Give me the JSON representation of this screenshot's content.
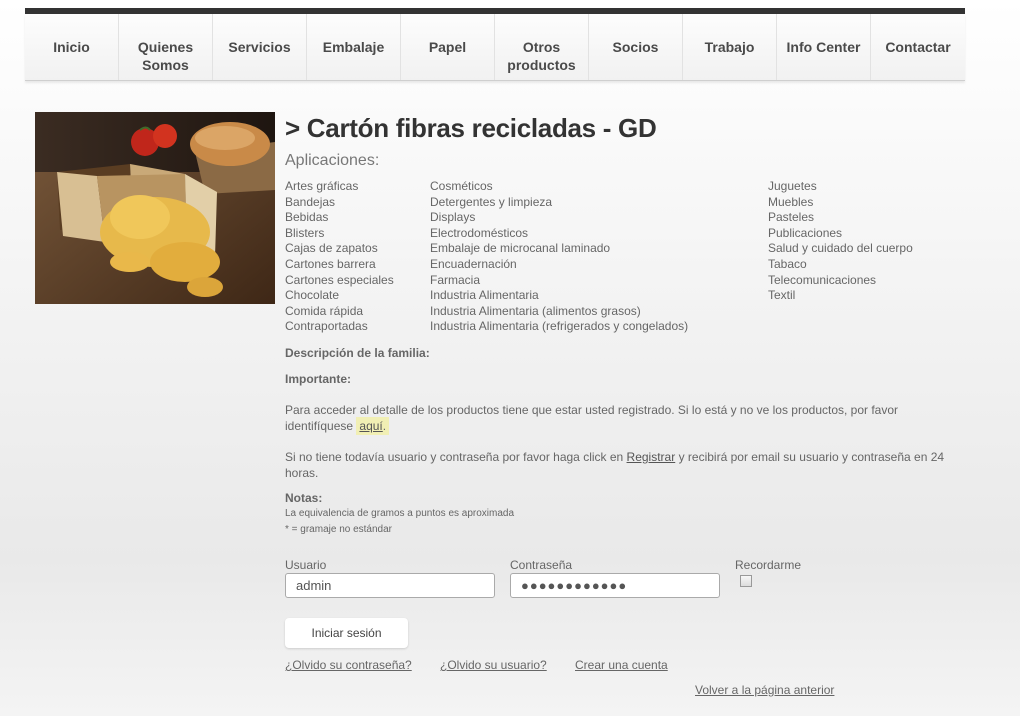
{
  "nav": {
    "items": [
      "Inicio",
      "Quienes\nSomos",
      "Servicios",
      "Embalaje",
      "Papel",
      "Otros\nproductos",
      "Socios",
      "Trabajo",
      "Info Center",
      "Contactar"
    ]
  },
  "product": {
    "title": "> Cartón fibras recicladas - GD",
    "applications_heading": "Aplicaciones:",
    "applications_col1": [
      "Artes gráficas",
      "Bandejas",
      "Bebidas",
      "Blisters",
      "Cajas de zapatos",
      "Cartones barrera",
      "Cartones especiales",
      "Chocolate",
      "Comida rápida",
      "Contraportadas"
    ],
    "applications_col2": [
      "Cosméticos",
      "Detergentes y limpieza",
      "Displays",
      "Electrodomésticos",
      "Embalaje de microcanal laminado",
      "Encuadernación",
      "Farmacia",
      "Industria Alimentaria",
      "Industria Alimentaria (alimentos grasos)",
      "Industria Alimentaria (refrigerados y congelados)"
    ],
    "applications_col3": [
      "Juguetes",
      "Muebles",
      "Pasteles",
      "Publicaciones",
      "Salud y cuidado del cuerpo",
      "Tabaco",
      "Telecomunicaciones",
      "Textil"
    ],
    "family_description_label": "Descripción de la familia:",
    "important_label": "Importante:",
    "access_text": "Para acceder al detalle de los productos tiene que estar usted registrado. Si lo está y no ve los productos, por favor identifíquese",
    "access_link": "aquí",
    "access_suffix": ".",
    "register_prefix": "Si no tiene todavía usuario y contraseña por favor haga click en",
    "register_link": "Registrar",
    "register_suffix": "y recibirá por email su usuario y contraseña en 24 horas.",
    "notes_label": "Notas:",
    "note1": "La equivalencia de gramos a puntos es aproximada",
    "note2": "* = gramaje no estándar"
  },
  "login": {
    "user_label": "Usuario",
    "user_value": "admin",
    "password_label": "Contraseña",
    "password_value": "●●●●●●●●●●●●",
    "remember_label": "Recordarme",
    "submit_label": "Iniciar sesión",
    "forgot_password": "¿Olvido su contraseña?",
    "forgot_user": "¿Olvido su usuario?",
    "create_account": "Crear una cuenta",
    "back_link": "Volver a la página anterior"
  }
}
